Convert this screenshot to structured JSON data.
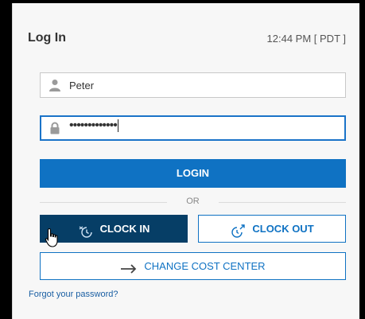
{
  "header": {
    "title": "Log In",
    "time": "12:44 PM [ PDT ]"
  },
  "username": {
    "value": "Peter",
    "icon": "user-icon"
  },
  "password": {
    "masked_value": "•••••••••••••",
    "icon": "lock-icon"
  },
  "login_button": {
    "label": "LOGIN"
  },
  "divider": {
    "label": "OR"
  },
  "clock_in_button": {
    "label": "CLOCK IN",
    "icon": "clock-in-icon"
  },
  "clock_out_button": {
    "label": "CLOCK OUT",
    "icon": "clock-out-icon"
  },
  "cost_center_button": {
    "label": "CHANGE COST CENTER",
    "icon": "arrow-right-icon"
  },
  "forgot_link": {
    "label": "Forgot your password?"
  },
  "colors": {
    "primary": "#0f72c3",
    "clock_in_bg": "#063e66",
    "panel_bg": "#f7f7f7"
  }
}
